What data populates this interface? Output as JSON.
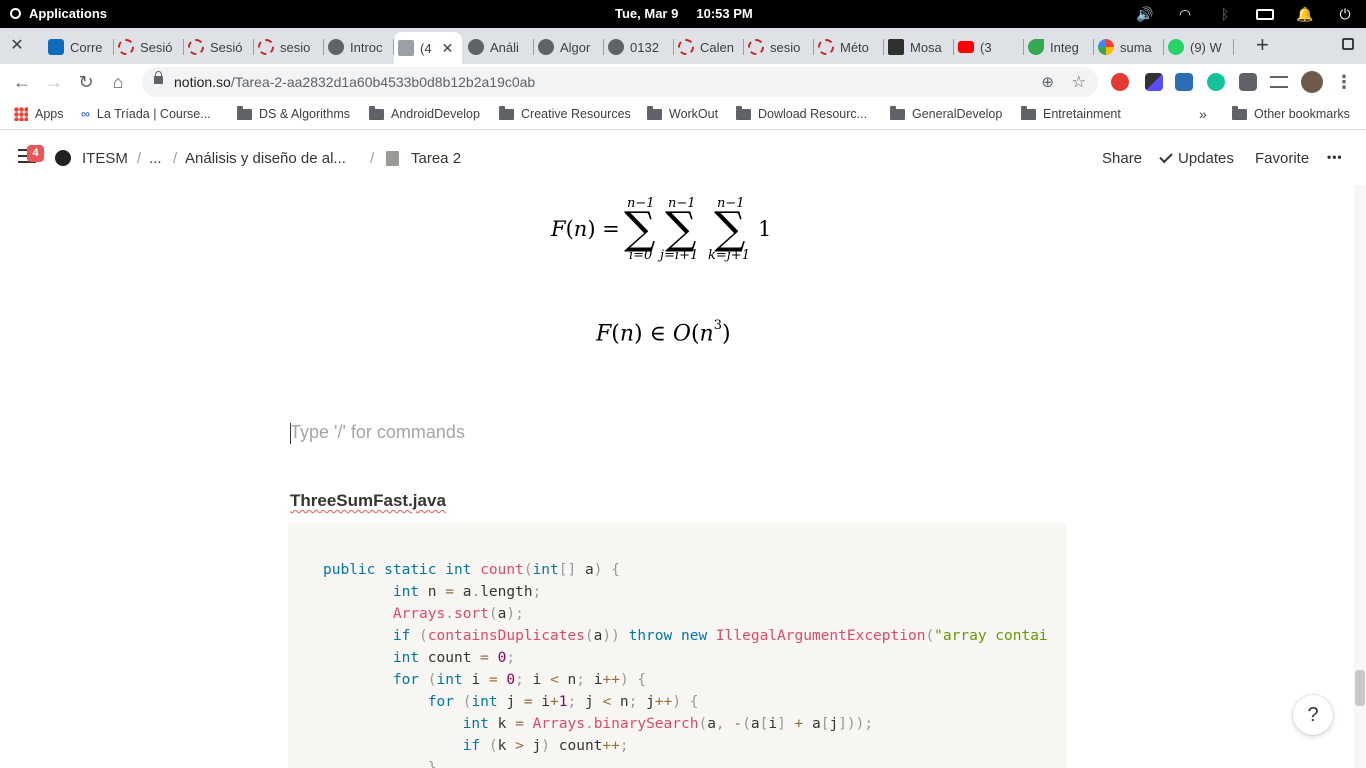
{
  "os_bar": {
    "menu_label": "Applications",
    "clock": "Tue, Mar 9     10:53 PM"
  },
  "tabs": [
    {
      "label": "Corre",
      "icon": "outlook-icon"
    },
    {
      "label": "Sesió",
      "icon": "red-ring-icon"
    },
    {
      "label": "Sesió",
      "icon": "red-ring-icon"
    },
    {
      "label": "sesio",
      "icon": "red-ring-icon"
    },
    {
      "label": "Introc",
      "icon": "globe-icon"
    },
    {
      "label": "(4",
      "icon": "document-icon",
      "active": true
    },
    {
      "label": "Análi",
      "icon": "globe-icon"
    },
    {
      "label": "Algor",
      "icon": "globe-icon"
    },
    {
      "label": "0132",
      "icon": "globe-icon"
    },
    {
      "label": "Calen",
      "icon": "red-ring-icon"
    },
    {
      "label": "sesio",
      "icon": "red-ring-icon"
    },
    {
      "label": "Méto",
      "icon": "red-ring-icon"
    },
    {
      "label": "Mosa",
      "icon": "mosaic-icon"
    },
    {
      "label": "(3",
      "icon": "youtube-icon"
    },
    {
      "label": "Integ",
      "icon": "leaf-icon"
    },
    {
      "label": "suma",
      "icon": "google-icon"
    },
    {
      "label": "(9) W",
      "icon": "whatsapp-icon"
    }
  ],
  "address_bar": {
    "domain": "notion.so",
    "path": "/Tarea-2-aa2832d1a60b4533b0d8b12b2a19c0ab"
  },
  "bookmarks": {
    "items": [
      "Apps",
      "La Tríada | Course...",
      "DS & Algorithms",
      "AndroidDevelop",
      "Creative Resources",
      "WorkOut",
      "Dowload Resourc...",
      "GeneralDevelop",
      "Entretainment"
    ],
    "overflow": "»",
    "other": "Other bookmarks"
  },
  "notion": {
    "badge_count": "4",
    "breadcrumb": {
      "workspace": "ITESM",
      "ellipsis": "...",
      "parent": "Análisis y diseño de al...",
      "page": "Tarea 2",
      "separator": "/"
    },
    "actions": {
      "share": "Share",
      "updates": "Updates",
      "favorite": "Favorite",
      "more": "•••"
    }
  },
  "content": {
    "equation_1": {
      "lhs": "F(n) =",
      "sums": [
        {
          "upper": "n−1",
          "lower": "i=0"
        },
        {
          "upper": "n−1",
          "lower": "j=i+1"
        },
        {
          "upper": "n−1",
          "lower": "k=j+1"
        }
      ],
      "summand": "1"
    },
    "equation_2": {
      "lhs": "F(n) ∈ O(n",
      "exponent": "3",
      "close": ")"
    },
    "placeholder": "Type '/' for commands",
    "heading": "ThreeSumFast.java",
    "code_lines": [
      "public static int count(int[] a) {",
      "        int n = a.length;",
      "        Arrays.sort(a);",
      "        if (containsDuplicates(a)) throw new IllegalArgumentException(\"array contai",
      "        int count = 0;",
      "        for (int i = 0; i < n; i++) {",
      "            for (int j = i+1; j < n; j++) {",
      "                int k = Arrays.binarySearch(a, -(a[i] + a[j]));",
      "                if (k > j) count++;",
      "            }"
    ]
  },
  "help_button": "?",
  "colors": {
    "code_keyword": "#0077aa",
    "code_function": "#dd4a68",
    "code_string": "#669900",
    "code_number": "#990055",
    "notion_badge": "#eb5757",
    "code_background": "#f7f6f3"
  }
}
